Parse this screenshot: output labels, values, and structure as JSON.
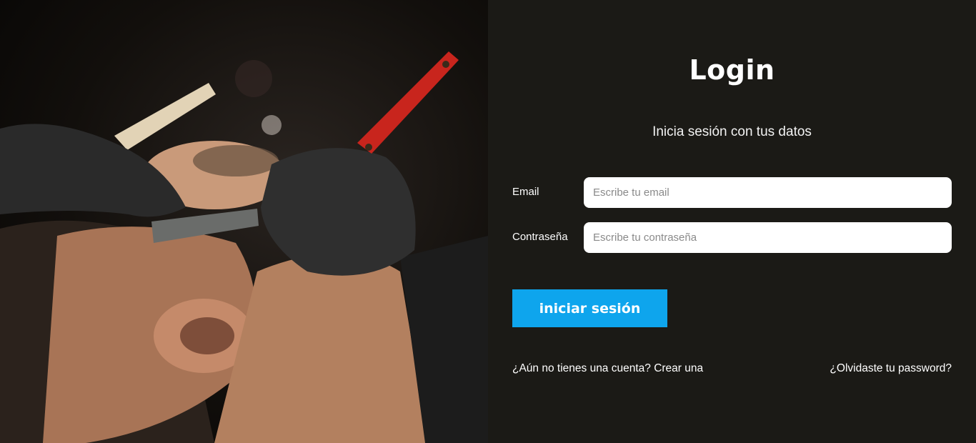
{
  "hero": {
    "image_subject": "barber-shaving-client-photo"
  },
  "login": {
    "title": "Login",
    "subtitle": "Inicia sesión con tus datos",
    "email": {
      "label": "Email",
      "placeholder": "Escribe tu email",
      "value": ""
    },
    "password": {
      "label": "Contraseña",
      "placeholder": "Escribe tu contraseña",
      "value": ""
    },
    "submit_label": "iniciar sesión",
    "register_link": "¿Aún no tienes una cuenta? Crear una",
    "forgot_link": "¿Olvidaste tu password?"
  },
  "colors": {
    "panel_background": "#1b1a16",
    "accent": "#0ea5ed",
    "text": "#ffffff",
    "input_background": "#ffffff"
  }
}
